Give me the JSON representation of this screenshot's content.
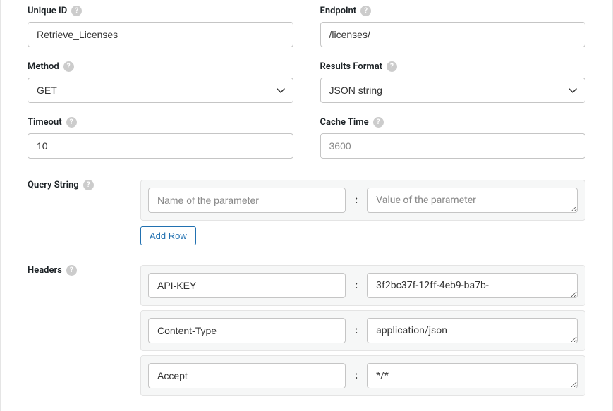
{
  "labels": {
    "unique_id": "Unique ID",
    "endpoint": "Endpoint",
    "method": "Method",
    "results_format": "Results Format",
    "timeout": "Timeout",
    "cache_time": "Cache Time",
    "query_string": "Query String",
    "headers": "Headers"
  },
  "fields": {
    "unique_id": "Retrieve_Licenses",
    "endpoint": "/licenses/",
    "method": "GET",
    "results_format": "JSON string",
    "timeout": "10",
    "cache_time_placeholder": "3600"
  },
  "query_string": {
    "name_placeholder": "Name of the parameter",
    "value_placeholder": "Value of the parameter",
    "rows": [
      {
        "name": "",
        "value": ""
      }
    ]
  },
  "headers": {
    "rows": [
      {
        "name": "API-KEY",
        "value": "3f2bc37f-12ff-4eb9-ba7b-"
      },
      {
        "name": "Content-Type",
        "value": "application/json"
      },
      {
        "name": "Accept",
        "value": "*/*"
      }
    ]
  },
  "buttons": {
    "add_row": "Add Row"
  },
  "separator": ":"
}
